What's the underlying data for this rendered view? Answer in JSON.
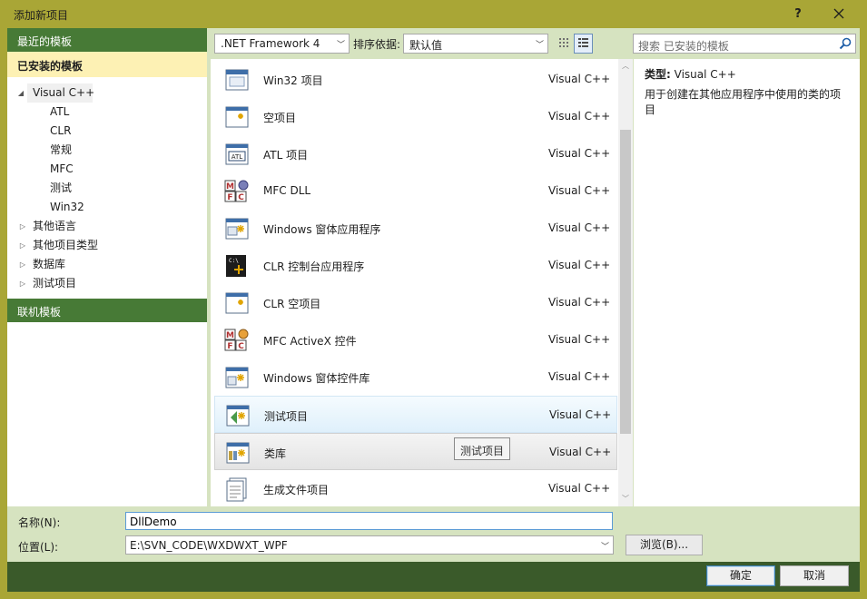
{
  "window": {
    "title": "添加新项目",
    "help": "?"
  },
  "left": {
    "recent_label": "最近的模板",
    "installed_label": "已安装的模板",
    "online_label": "联机模板",
    "tree": [
      {
        "label": "Visual C++",
        "expanded": true
      },
      {
        "label": "ATL"
      },
      {
        "label": "CLR"
      },
      {
        "label": "常规"
      },
      {
        "label": "MFC"
      },
      {
        "label": "测试"
      },
      {
        "label": "Win32"
      },
      {
        "label": "其他语言",
        "expanded": false
      },
      {
        "label": "其他项目类型",
        "expanded": false
      },
      {
        "label": "数据库",
        "expanded": false
      },
      {
        "label": "测试项目",
        "expanded": false
      }
    ]
  },
  "toolbar": {
    "framework": ".NET Framework 4",
    "sort_label": "排序依据:",
    "sort_value": "默认值",
    "search_placeholder": "搜索 已安装的模板"
  },
  "templates": [
    {
      "name": "Win32 项目",
      "lang": "Visual C++",
      "icon": "win32-icon"
    },
    {
      "name": "空项目",
      "lang": "Visual C++",
      "icon": "empty-project-icon"
    },
    {
      "name": "ATL 项目",
      "lang": "Visual C++",
      "icon": "atl-icon"
    },
    {
      "name": "MFC DLL",
      "lang": "Visual C++",
      "icon": "mfc-dll-icon"
    },
    {
      "name": "Windows 窗体应用程序",
      "lang": "Visual C++",
      "icon": "windows-forms-icon"
    },
    {
      "name": "CLR 控制台应用程序",
      "lang": "Visual C++",
      "icon": "clr-console-icon"
    },
    {
      "name": "CLR 空项目",
      "lang": "Visual C++",
      "icon": "clr-empty-icon"
    },
    {
      "name": "MFC ActiveX 控件",
      "lang": "Visual C++",
      "icon": "mfc-activex-icon"
    },
    {
      "name": "Windows 窗体控件库",
      "lang": "Visual C++",
      "icon": "windows-forms-control-icon"
    },
    {
      "name": "测试项目",
      "lang": "Visual C++",
      "icon": "test-project-icon"
    },
    {
      "name": "类库",
      "lang": "Visual C++",
      "icon": "class-library-icon"
    },
    {
      "name": "生成文件项目",
      "lang": "Visual C++",
      "icon": "makefile-project-icon"
    }
  ],
  "tooltip": "测试项目",
  "details": {
    "type_label": "类型:",
    "type_value": "Visual C++",
    "description": "用于创建在其他应用程序中使用的类的项目"
  },
  "form": {
    "name_label": "名称(N):",
    "name_value": "DllDemo",
    "location_label": "位置(L):",
    "location_value": "E:\\SVN_CODE\\WXDWXT_WPF",
    "browse_label": "浏览(B)...",
    "ok_label": "确定",
    "cancel_label": "取消"
  },
  "colors": {
    "frame": "#a9a636",
    "header_green": "#477a36",
    "installed_highlight": "#fdf1b4",
    "client_bg": "#d6e3c0",
    "bottom_bar": "#3a5a2a"
  }
}
